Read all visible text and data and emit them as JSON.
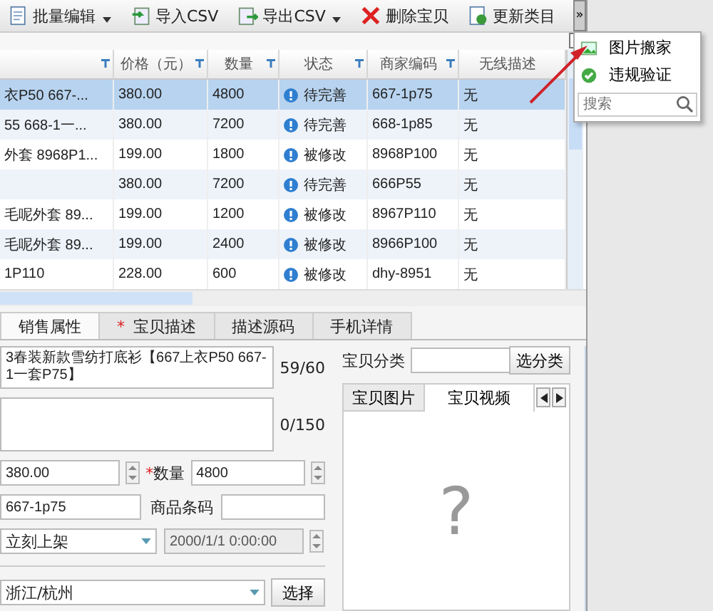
{
  "toolbar": {
    "buttons": [
      {
        "label": "批量编辑",
        "dropdown": true
      },
      {
        "label": "导入CSV",
        "dropdown": false
      },
      {
        "label": "导出CSV",
        "dropdown": true
      },
      {
        "label": "删除宝贝",
        "dropdown": false
      },
      {
        "label": "更新类目",
        "dropdown": false
      }
    ],
    "overflow": "»"
  },
  "table": {
    "columns": [
      {
        "filter": true
      },
      {
        "label": "价格（元）",
        "filter": true
      },
      {
        "label": "数量",
        "filter": true
      },
      {
        "label": "状态",
        "filter": true
      },
      {
        "label": "商家编码",
        "filter": true
      },
      {
        "label": "无线描述",
        "filter": false
      }
    ],
    "rows": [
      {
        "selected": true,
        "title": "衣P50 667-...",
        "price": "380.00",
        "quantity": "4800",
        "status": "待完善",
        "code": "667-1p75",
        "wireless": "无"
      },
      {
        "selected": false,
        "title": "55 668-1一...",
        "price": "380.00",
        "quantity": "7200",
        "status": "待完善",
        "code": "668-1p85",
        "wireless": "无"
      },
      {
        "selected": false,
        "title": "外套 8968P1...",
        "price": "199.00",
        "quantity": "1800",
        "status": "被修改",
        "code": "8968P100",
        "wireless": "无"
      },
      {
        "selected": false,
        "price": "380.00",
        "quantity": "7200",
        "status": "待完善",
        "code": "666P55",
        "wireless": "无"
      },
      {
        "selected": false,
        "title": "毛呢外套 89...",
        "price": "199.00",
        "quantity": "1200",
        "status": "被修改",
        "code": "8967P110",
        "wireless": "无"
      },
      {
        "selected": false,
        "title": "毛呢外套 89...",
        "price": "199.00",
        "quantity": "2400",
        "status": "被修改",
        "code": "8966P100",
        "wireless": "无"
      },
      {
        "selected": false,
        "title": "1P110",
        "price": "228.00",
        "quantity": "600",
        "status": "被修改",
        "code": "dhy-8951",
        "wireless": "无"
      }
    ]
  },
  "menu": {
    "items": [
      {
        "label": "图片搬家"
      },
      {
        "label": "违规验证"
      }
    ],
    "search": {
      "placeholder": "搜索"
    }
  },
  "tabs": [
    {
      "label": "销售属性",
      "selected": true
    },
    {
      "label": "宝贝描述",
      "selected": false,
      "mark": "*"
    },
    {
      "label": "描述源码",
      "selected": false
    },
    {
      "label": "手机详情",
      "selected": false
    }
  ],
  "form": {
    "title": {
      "value": "3春装新款雪纺打底衫【667上衣P50 667-1一套P75】",
      "counter": "59/60"
    },
    "description": {
      "counter": "0/150"
    },
    "price": {
      "value": "380.00"
    },
    "quantity": {
      "mark": "*",
      "label": "数量",
      "value": "4800"
    },
    "code": {
      "value": "667-1p75"
    },
    "barcode": {
      "label": "商品条码"
    },
    "listing": {
      "value": "立刻上架"
    },
    "datetime": {
      "value": "2000/1/1 0:00:00",
      "disabled": true
    },
    "location": {
      "value": "浙江/杭州",
      "button": "选择"
    },
    "category": {
      "label": "宝贝分类",
      "button": "选分类"
    },
    "media_tabs": [
      {
        "label": "宝贝图片",
        "selected": false
      },
      {
        "label": "宝贝视频",
        "selected": true
      }
    ],
    "placeholder_mark": "?"
  }
}
